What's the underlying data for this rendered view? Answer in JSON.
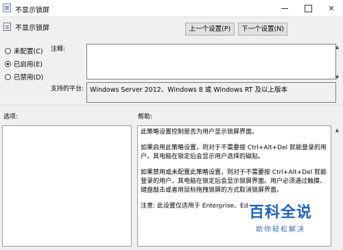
{
  "window": {
    "title": "不显示锁屏",
    "controls": {
      "minimize": "minimize-icon",
      "maximize": "maximize-icon",
      "close": "close-icon"
    }
  },
  "header": {
    "policy_name": "不显示锁屏",
    "prev_button": "上一个设置(P)",
    "next_button": "下一个设置(N)"
  },
  "state_options": [
    {
      "label": "未配置(C)",
      "checked": false
    },
    {
      "label": "已启用(E)",
      "checked": true
    },
    {
      "label": "已禁用(D)",
      "checked": false
    }
  ],
  "comment": {
    "label": "注释:",
    "value": ""
  },
  "supported": {
    "label": "支持的平台:",
    "value": "Windows Server 2012、Windows 8 或 Windows RT 及以上版本"
  },
  "options": {
    "label": "选项:"
  },
  "help": {
    "label": "帮助:",
    "paragraphs": [
      "此策略设置控制是否为用户显示锁屏界面。",
      "如果启用此策略设置，则对于不需要按 Ctrl+Alt+Del 就能登录的用户，其电脑在锁定后会显示用户选择的磁贴。",
      "如果禁用或未配置此策略设置，则对于不需要按 Ctrl+Alt+Del 就能登录的用户，其电脑在锁定后会显示锁屏界面。用户必须通过触摸、键盘敲击或者用鼠标拖拽锁屏的方式取消锁屏界面。",
      "注意: 此设置仅适用于 Enterprise、Ed"
    ]
  },
  "watermark": {
    "main": "百科全说",
    "sub": "助你轻松解决"
  }
}
